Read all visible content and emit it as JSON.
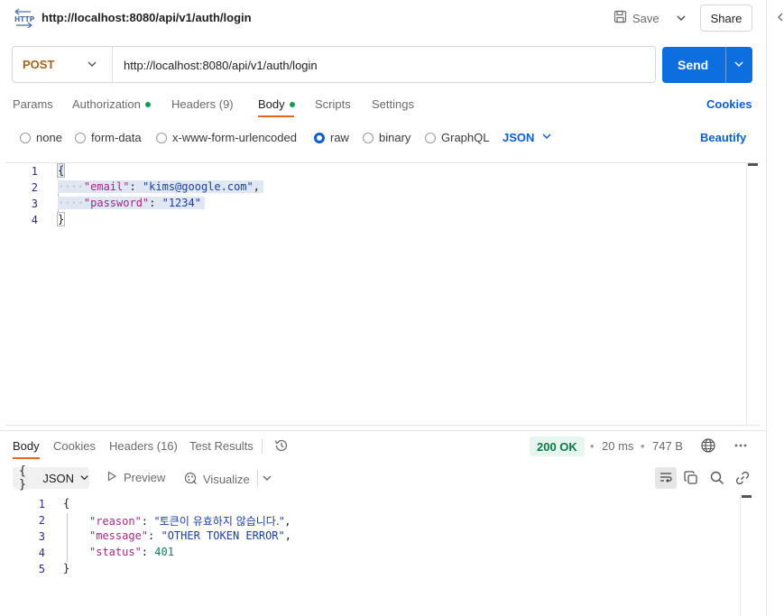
{
  "header": {
    "http_icon_label": "HTTP",
    "title": "http://localhost:8080/api/v1/auth/login",
    "save_label": "Save",
    "share_label": "Share"
  },
  "request": {
    "method": "POST",
    "url": "http://localhost:8080/api/v1/auth/login",
    "send_label": "Send"
  },
  "request_tabs": [
    {
      "label": "Params",
      "active": false,
      "dot": false
    },
    {
      "label": "Authorization",
      "active": false,
      "dot": true
    },
    {
      "label": "Headers (9)",
      "active": false,
      "dot": false
    },
    {
      "label": "Body",
      "active": true,
      "dot": true
    },
    {
      "label": "Scripts",
      "active": false,
      "dot": false
    },
    {
      "label": "Settings",
      "active": false,
      "dot": false
    }
  ],
  "cookies_label": "Cookies",
  "body_types": [
    {
      "label": "none",
      "selected": false
    },
    {
      "label": "form-data",
      "selected": false
    },
    {
      "label": "x-www-form-urlencoded",
      "selected": false
    },
    {
      "label": "raw",
      "selected": true
    },
    {
      "label": "binary",
      "selected": false
    },
    {
      "label": "GraphQL",
      "selected": false
    }
  ],
  "raw_format": "JSON",
  "beautify_label": "Beautify",
  "request_body": {
    "line_numbers": [
      "1",
      "2",
      "3",
      "4"
    ],
    "open_brace": "{",
    "close_brace": "}",
    "indent_marker": "····",
    "email_key": "\"email\"",
    "email_value": "\"kims@google.com\"",
    "password_key": "\"password\"",
    "password_value": "\"1234\""
  },
  "response_tabs": [
    {
      "label": "Body",
      "active": true
    },
    {
      "label": "Cookies",
      "active": false
    },
    {
      "label": "Headers (16)",
      "active": false
    },
    {
      "label": "Test Results",
      "active": false
    }
  ],
  "response_meta": {
    "status": "200 OK",
    "time": "20 ms",
    "size": "747 B",
    "status_color": "#0b7a46"
  },
  "response_toolbar": {
    "format": "JSON",
    "format_icon": "{ }",
    "preview_label": "Preview",
    "visualize_label": "Visualize"
  },
  "response_body": {
    "line_numbers": [
      "1",
      "2",
      "3",
      "4",
      "5"
    ],
    "open_brace": "{",
    "close_brace": "}",
    "reason_key": "\"reason\"",
    "reason_value": "\"토큰이 유효하지 않습니다.\"",
    "message_key": "\"message\"",
    "message_value": "\"OTHER TOKEN ERROR\"",
    "status_key": "\"status\"",
    "status_value": "401"
  },
  "colors": {
    "accent_blue": "#0b6fe0",
    "method_orange": "#a4631c",
    "active_tab_underline": "#e36a1e",
    "dot_green": "#0e9e5a"
  },
  "icons": [
    "http-icon",
    "save-icon",
    "chevron-down-icon",
    "chevron-left-icon",
    "history-icon",
    "globe-icon",
    "more-icon",
    "play-icon",
    "visualize-icon",
    "wrap-icon",
    "copy-icon",
    "search-icon",
    "link-icon"
  ]
}
